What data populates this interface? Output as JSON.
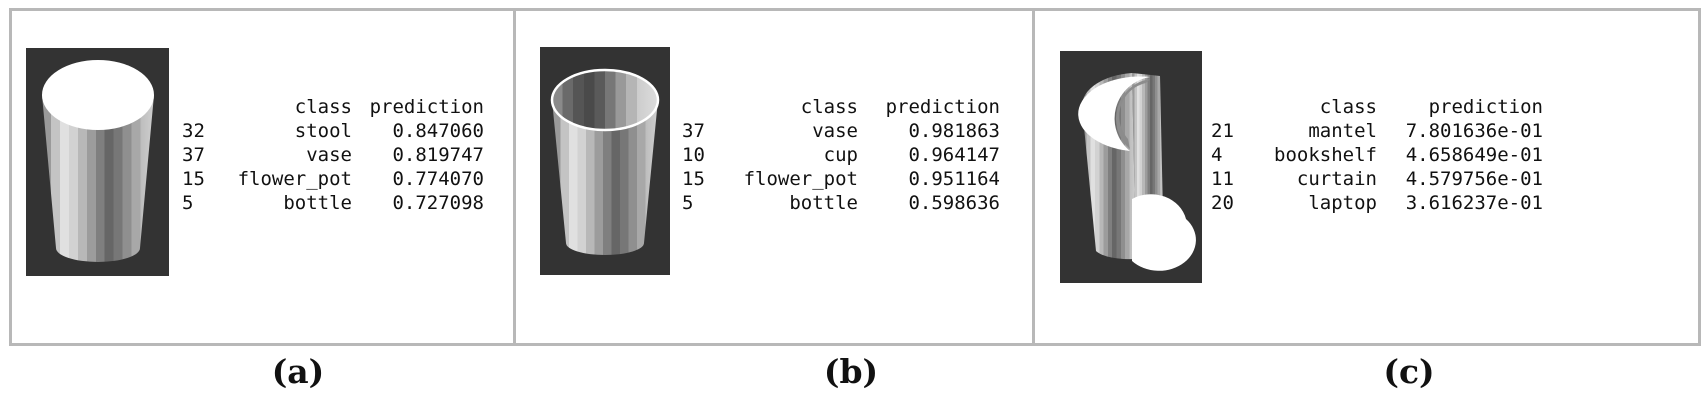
{
  "panels": [
    {
      "caption": "(a)",
      "header": {
        "index": "",
        "class": "class",
        "prediction": "prediction"
      },
      "rows": [
        {
          "index": "32",
          "class": "stool",
          "prediction": "0.847060"
        },
        {
          "index": "37",
          "class": "vase",
          "prediction": "0.819747"
        },
        {
          "index": "15",
          "class": "flower_pot",
          "prediction": "0.774070"
        },
        {
          "index": "5",
          "class": "bottle",
          "prediction": "0.727098"
        }
      ]
    },
    {
      "caption": "(b)",
      "header": {
        "index": "",
        "class": "class",
        "prediction": "prediction"
      },
      "rows": [
        {
          "index": "37",
          "class": "vase",
          "prediction": "0.981863"
        },
        {
          "index": "10",
          "class": "cup",
          "prediction": "0.964147"
        },
        {
          "index": "15",
          "class": "flower_pot",
          "prediction": "0.951164"
        },
        {
          "index": "5",
          "class": "bottle",
          "prediction": "0.598636"
        }
      ]
    },
    {
      "caption": "(c)",
      "header": {
        "index": "",
        "class": "class",
        "prediction": "prediction"
      },
      "rows": [
        {
          "index": "21",
          "class": "mantel",
          "prediction": "7.801636e-01"
        },
        {
          "index": "4",
          "class": "bookshelf",
          "prediction": "4.658649e-01"
        },
        {
          "index": "11",
          "class": "curtain",
          "prediction": "4.579756e-01"
        },
        {
          "index": "20",
          "class": "laptop",
          "prediction": "3.616237e-01"
        }
      ]
    }
  ],
  "colors": {
    "render_background": "#333333",
    "frame_border": "#b8b8b8"
  }
}
